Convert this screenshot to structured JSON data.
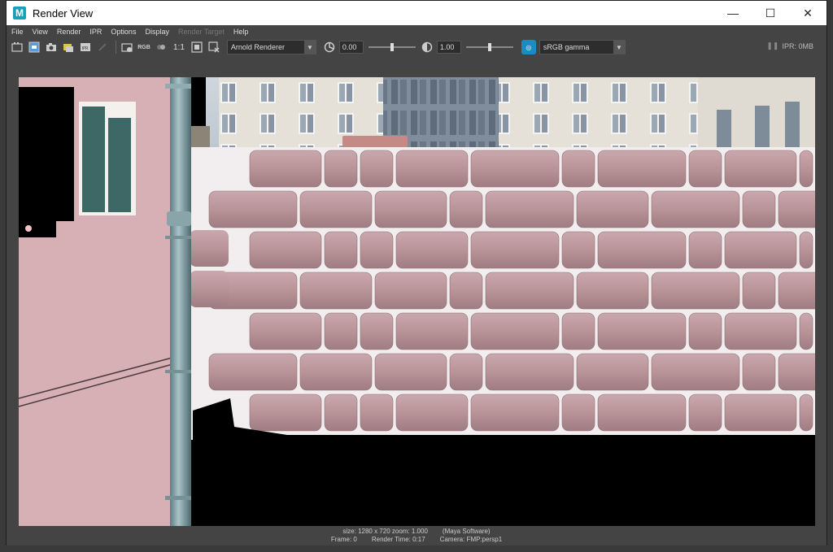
{
  "window": {
    "title": "Render View",
    "app_icon_letter": "M",
    "controls": {
      "minimize": "—",
      "maximize": "☐",
      "close": "✕"
    }
  },
  "menu": [
    "File",
    "View",
    "Render",
    "IPR",
    "Options",
    "Display",
    "Render Target",
    "Help"
  ],
  "menu_disabled_index": 6,
  "toolbar": {
    "rgb_label": "RGB",
    "ratio_label": "1:1",
    "ipr_label": "IPR",
    "renderer": "Arnold Renderer",
    "exposure": "0.00",
    "gamma": "1.00",
    "exposure_fraction": 0.5,
    "gamma_fraction": 0.5,
    "view_transform": "sRGB gamma",
    "ipr_memory": "IPR: 0MB"
  },
  "status": {
    "size": "size: 1280 x 720 zoom: 1.000",
    "renderer": "(Maya Software)",
    "frame": "Frame: 0",
    "render_time": "Render Time: 0:17",
    "camera": "Camera: FMP:persp1"
  },
  "colors": {
    "title_bg": "#ffffff",
    "panel_bg": "#444444",
    "accent": "#1c8bc0",
    "brick": "#bf9ea3",
    "wall": "#dcb7bb"
  },
  "icons": {
    "redo": "redo-render-icon",
    "snapshot": "snapshot-icon",
    "ipr": "ipr-render-icon"
  }
}
